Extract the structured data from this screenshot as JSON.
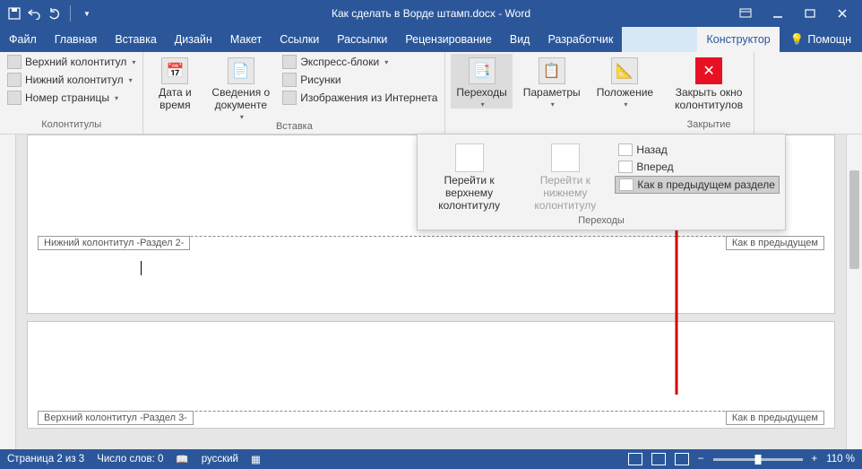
{
  "title": "Как сделать в Ворде штамп.docx - Word",
  "tabs": {
    "file": "Файл",
    "home": "Главная",
    "insert": "Вставка",
    "design": "Дизайн",
    "layout": "Макет",
    "references": "Ссылки",
    "mailings": "Рассылки",
    "review": "Рецензирование",
    "view": "Вид",
    "developer": "Разработчик",
    "constructor": "Конструктор",
    "help": "Помощн"
  },
  "ribbon": {
    "group_hf": {
      "header": "Верхний колонтитул",
      "footer": "Нижний колонтитул",
      "page_number": "Номер страницы",
      "label": "Колонтитулы"
    },
    "group_insert": {
      "date_time": "Дата и\nвремя",
      "doc_info": "Сведения о\nдокументе",
      "quick_parts": "Экспресс-блоки",
      "pictures": "Рисунки",
      "online_pictures": "Изображения из Интернета",
      "label": "Вставка"
    },
    "group_nav": {
      "transitions": "Переходы",
      "parameters": "Параметры",
      "position": "Положение",
      "label": ""
    },
    "group_close": {
      "close": "Закрыть окно\nколонтитулов",
      "label": "Закрытие"
    }
  },
  "dropdown": {
    "go_top": "Перейти к верхнему\nколонтитулу",
    "go_bottom": "Перейти к нижнему\nколонтитулу",
    "back": "Назад",
    "forward": "Вперед",
    "link_previous": "Как в предыдущем разделе",
    "label": "Переходы"
  },
  "document": {
    "footer_tag": "Нижний колонтитул -Раздел 2-",
    "header_tag": "Верхний колонтитул -Раздел 3-",
    "same_as_prev": "Как в предыдущем"
  },
  "statusbar": {
    "page": "Страница 2 из 3",
    "words": "Число слов: 0",
    "lang": "русский",
    "zoom": "110 %"
  }
}
